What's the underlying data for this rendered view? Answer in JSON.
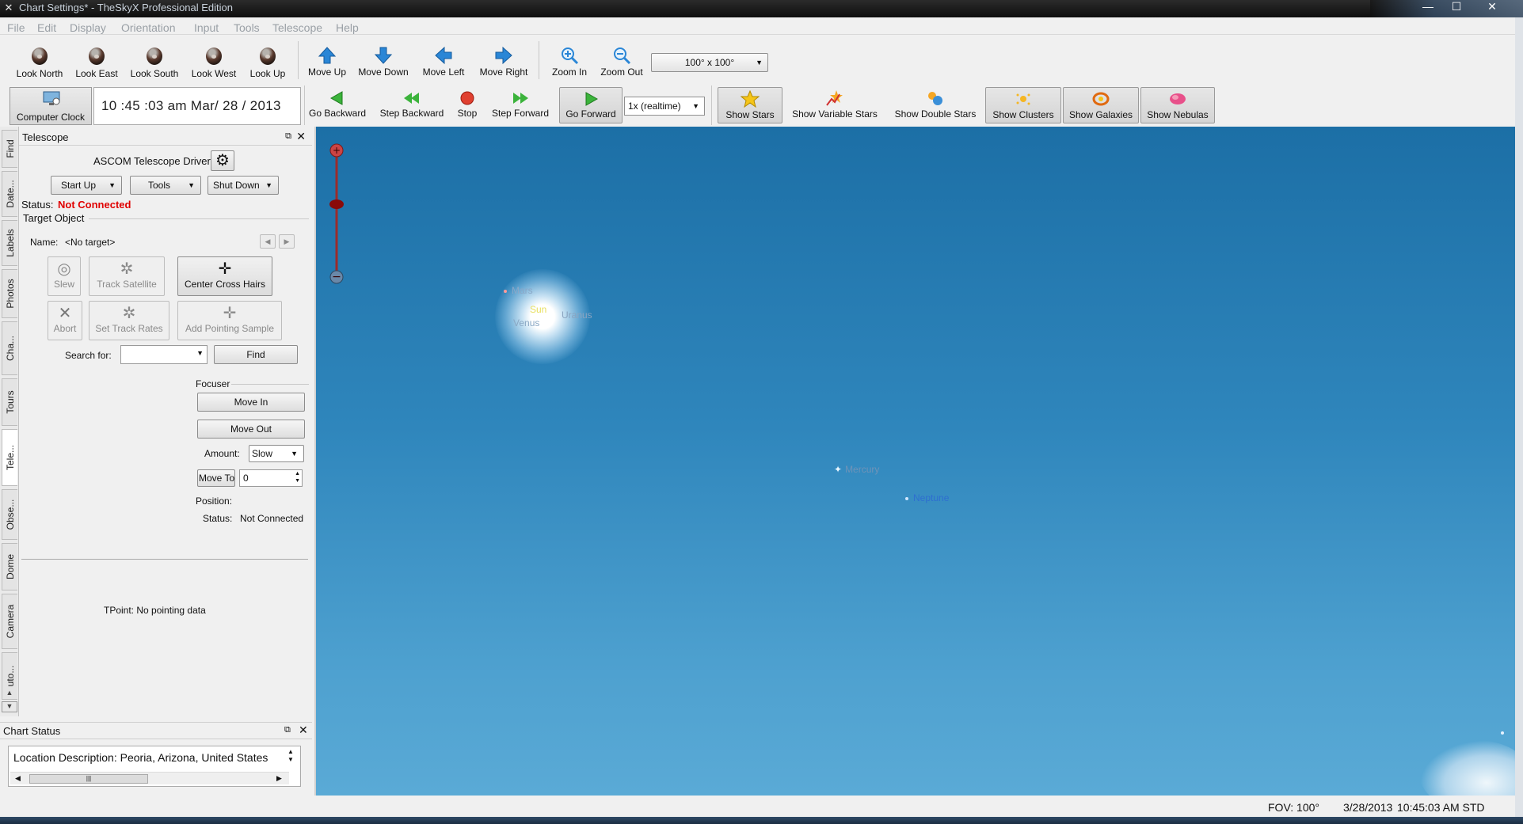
{
  "window": {
    "title": "Chart Settings* - TheSkyX Professional Edition",
    "controls": {
      "minimize": "—",
      "maximize": "☐",
      "close": "✕"
    }
  },
  "menu": [
    "File",
    "Edit",
    "Display",
    "Orientation",
    "Input",
    "Tools",
    "Telescope",
    "Help"
  ],
  "toolbar1": {
    "look": [
      "Look North",
      "Look East",
      "Look South",
      "Look West",
      "Look Up"
    ],
    "move": [
      "Move Up",
      "Move Down",
      "Move Left",
      "Move Right"
    ],
    "zoom": [
      "Zoom In",
      "Zoom Out"
    ],
    "fov_value": "100° x 100°"
  },
  "toolbar2": {
    "computer_clock": "Computer Clock",
    "clock_display": "10 :45 :03  am  Mar/ 28 / 2013",
    "time_buttons": [
      "Go Backward",
      "Step Backward",
      "Stop",
      "Step Forward",
      "Go Forward"
    ],
    "rate_value": "1x (realtime)",
    "show_buttons": [
      "Show Stars",
      "Show Variable Stars",
      "Show Double Stars",
      "Show Clusters",
      "Show Galaxies",
      "Show Nebulas"
    ]
  },
  "side_tabs": [
    "Find",
    "Date...",
    "Labels",
    "Photos",
    "Cha...",
    "Tours",
    "Tele...",
    "Obse...",
    "Dome",
    "Camera",
    "uto..."
  ],
  "telescope": {
    "panel_title": "Telescope",
    "driver": "ASCOM Telescope Driver",
    "startup": "Start Up",
    "tools": "Tools",
    "shutdown": "Shut Down",
    "status_label": "Status:",
    "status_value": "Not Connected",
    "target_group": "Target Object",
    "name_label": "Name:",
    "name_value": "<No target>",
    "slew": "Slew",
    "track_satellite": "Track Satellite",
    "center_cross_hairs": "Center Cross Hairs",
    "abort": "Abort",
    "set_track_rates": "Set Track Rates",
    "add_pointing_sample": "Add Pointing Sample",
    "search_label": "Search for:",
    "search_value": "",
    "find": "Find",
    "focuser_group": "Focuser",
    "move_in": "Move In",
    "move_out": "Move Out",
    "amount_label": "Amount:",
    "amount_value": "Slow",
    "move_to": "Move To",
    "move_to_value": "0",
    "position_label": "Position:",
    "focuser_status_label": "Status:",
    "focuser_status_value": "Not Connected",
    "tpoint": "TPoint: No pointing data"
  },
  "chart_status": {
    "panel_title": "Chart Status",
    "location": "Location Description:  Peoria, Arizona, United States"
  },
  "sky": {
    "planets": [
      "Mars",
      "Sun",
      "Uranus",
      "Venus",
      "Mercury",
      "Neptune"
    ]
  },
  "statusbar": {
    "fov": "FOV: 100°",
    "date": "3/28/2013",
    "time": "10:45:03 AM STD"
  },
  "colors": {
    "status_red": "#e00000",
    "sky_top": "#1c6fa6",
    "sky_bottom": "#5aaad6"
  }
}
